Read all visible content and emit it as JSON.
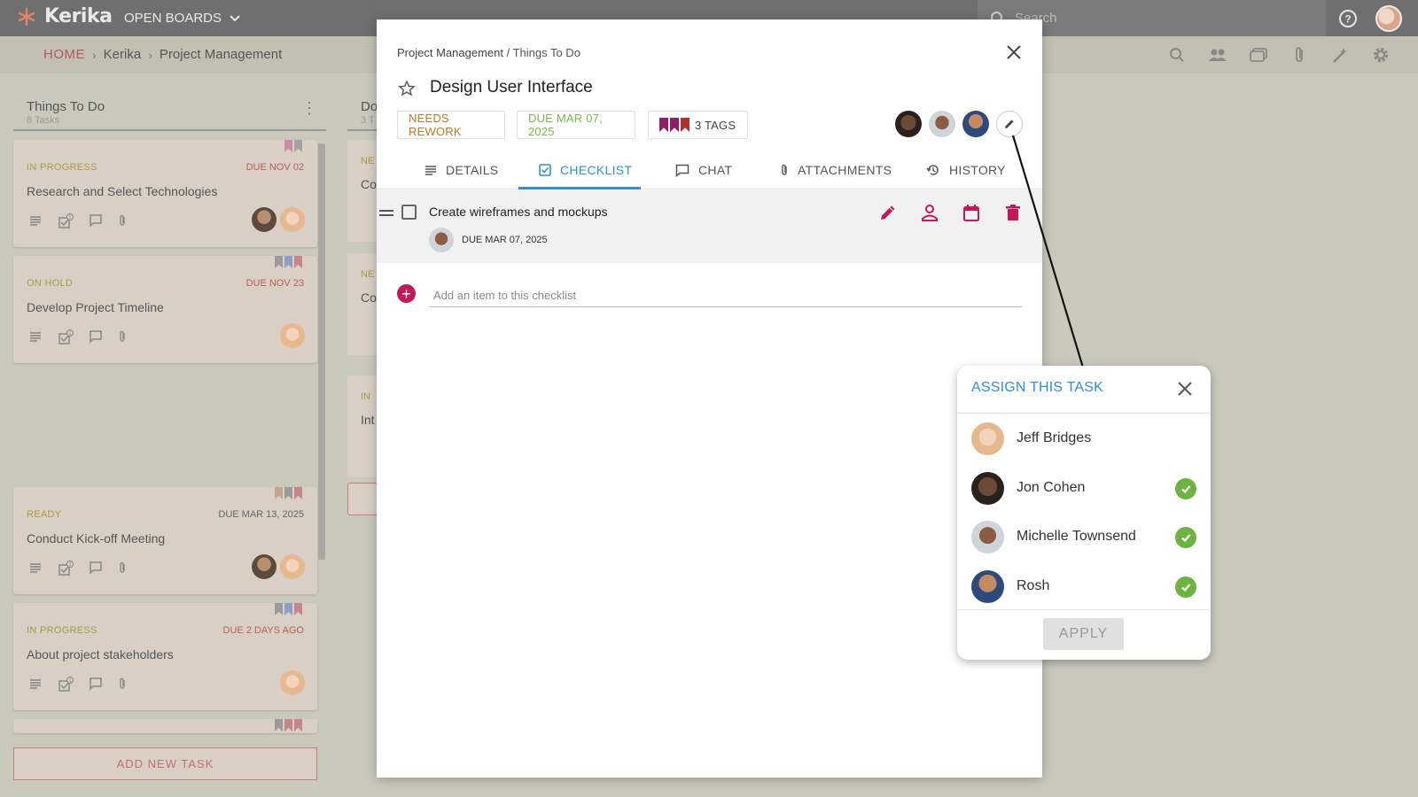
{
  "app": {
    "logo_text": "Kerika",
    "open_boards_label": "OPEN BOARDS",
    "search_placeholder": "Search"
  },
  "breadcrumb": {
    "home": "HOME",
    "org": "Kerika",
    "board": "Project Management"
  },
  "column1": {
    "title": "Things To Do",
    "count": "8 Tasks",
    "add_task_label": "ADD NEW TASK",
    "cards": [
      {
        "status": "IN PROGRESS",
        "due": "DUE NOV 02",
        "name": "Research and Select Technologies",
        "checklist_count": "1"
      },
      {
        "status": "ON HOLD",
        "due": "DUE NOV 23",
        "name": "Develop Project Timeline",
        "checklist_count": "1"
      },
      {
        "status": "READY",
        "due": "DUE MAR 13, 2025",
        "name": "Conduct Kick-off Meeting",
        "checklist_count": "1"
      },
      {
        "status": "IN PROGRESS",
        "due": "DUE 2 DAYS AGO",
        "name": "About project stakeholders",
        "checklist_count": "1"
      }
    ]
  },
  "column2": {
    "title_fragment": "Do",
    "count_fragment": "3 T",
    "stubs": [
      {
        "status": "NE",
        "name": "Co"
      },
      {
        "status": "NE",
        "name": "Co"
      },
      {
        "status": "IN",
        "name": "Int"
      }
    ]
  },
  "modal": {
    "path_board": "Project Management",
    "path_sep": " / ",
    "path_column": "Things To Do",
    "task_title": "Design User Interface",
    "status_chip": "NEEDS REWORK",
    "due_chip": "DUE MAR 07, 2025",
    "tags_chip": "3 TAGS",
    "tabs": [
      {
        "label": "DETAILS",
        "icon": "details-icon"
      },
      {
        "label": "CHECKLIST",
        "icon": "checklist-icon"
      },
      {
        "label": "CHAT",
        "icon": "chat-icon"
      },
      {
        "label": "ATTACHMENTS",
        "icon": "attachment-icon"
      },
      {
        "label": "HISTORY",
        "icon": "history-icon"
      }
    ],
    "checklist": {
      "item_text": "Create wireframes and mockups",
      "item_due": "DUE MAR 07, 2025",
      "add_placeholder": "Add an item to this checklist"
    }
  },
  "assign_popup": {
    "title": "ASSIGN THIS TASK",
    "apply_label": "APPLY",
    "people": [
      {
        "name": "Jeff Bridges",
        "selected": false
      },
      {
        "name": "Jon Cohen",
        "selected": true
      },
      {
        "name": "Michelle Townsend",
        "selected": true
      },
      {
        "name": "Rosh",
        "selected": true
      }
    ]
  },
  "colors": {
    "accent_blue": "#2e91d6",
    "pink": "#c2185b",
    "green_check": "#6db33f",
    "rework_orange": "#c27821",
    "due_green": "#7bb64a"
  }
}
